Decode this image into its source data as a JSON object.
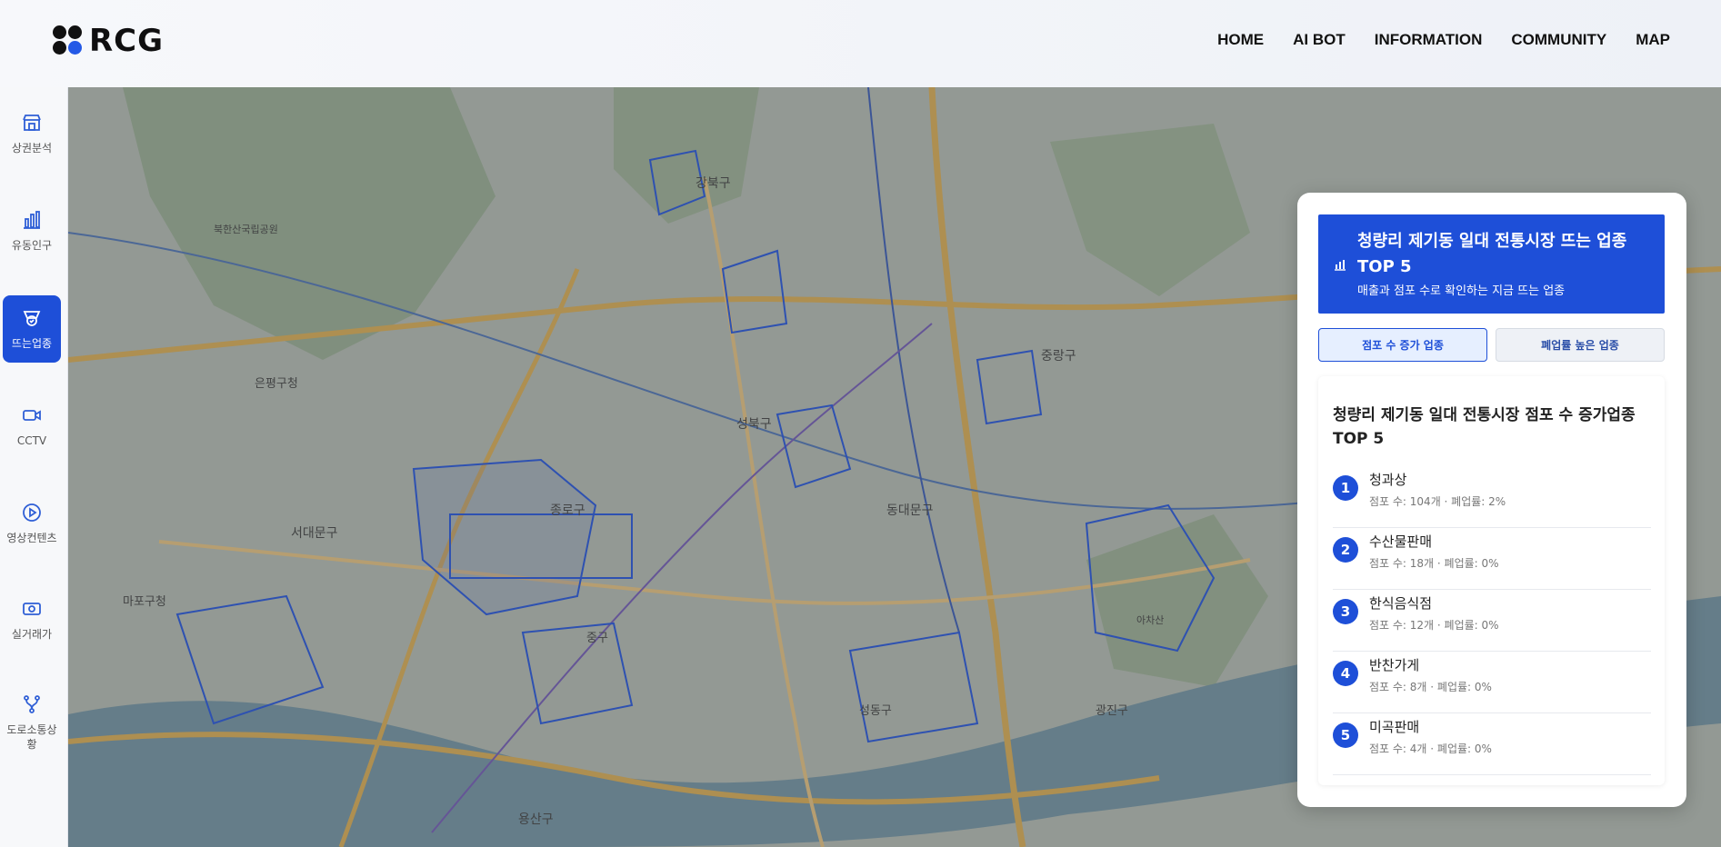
{
  "header": {
    "logo_text": "RCG",
    "nav": [
      "HOME",
      "AI BOT",
      "INFORMATION",
      "COMMUNITY",
      "MAP"
    ]
  },
  "sidebar": {
    "items": [
      {
        "label": "상권분석",
        "icon": "store-icon"
      },
      {
        "label": "유동인구",
        "icon": "bar-chart-icon"
      },
      {
        "label": "뜨는업종",
        "icon": "trending-badge-icon",
        "active": true
      },
      {
        "label": "CCTV",
        "icon": "camera-icon"
      },
      {
        "label": "영상컨텐츠",
        "icon": "play-icon"
      },
      {
        "label": "실거래가",
        "icon": "money-icon"
      },
      {
        "label": "도로소통상황",
        "icon": "route-icon"
      }
    ]
  },
  "map": {
    "labels": [
      "강북구",
      "성북구",
      "종로구",
      "동대문구",
      "중랑구",
      "서대문구",
      "마포구청",
      "은평구청",
      "용산구",
      "성동구",
      "광진구",
      "중구",
      "북한산국립공원",
      "아차산"
    ]
  },
  "panel": {
    "header_title": "청량리 제기동 일대 전통시장 뜨는 업종 TOP 5",
    "header_subtitle": "매출과 점포 수로 확인하는 지금 뜨는 업종",
    "tabs": [
      "점포 수 증가 업종",
      "폐업률 높은 업종"
    ],
    "active_tab": 0,
    "list_title": "청량리 제기동 일대 전통시장 점포 수 증가업종 TOP 5",
    "items": [
      {
        "rank": "1",
        "name": "청과상",
        "meta": "점포 수: 104개 · 폐업률: 2%"
      },
      {
        "rank": "2",
        "name": "수산물판매",
        "meta": "점포 수: 18개 · 폐업률: 0%"
      },
      {
        "rank": "3",
        "name": "한식음식점",
        "meta": "점포 수: 12개 · 폐업률: 0%"
      },
      {
        "rank": "4",
        "name": "반찬가게",
        "meta": "점포 수: 8개 · 폐업률: 0%"
      },
      {
        "rank": "5",
        "name": "미곡판매",
        "meta": "점포 수: 4개 · 폐업률: 0%"
      }
    ]
  },
  "colors": {
    "accent": "#1e4fd8",
    "logo_dot": "#2459e6"
  }
}
